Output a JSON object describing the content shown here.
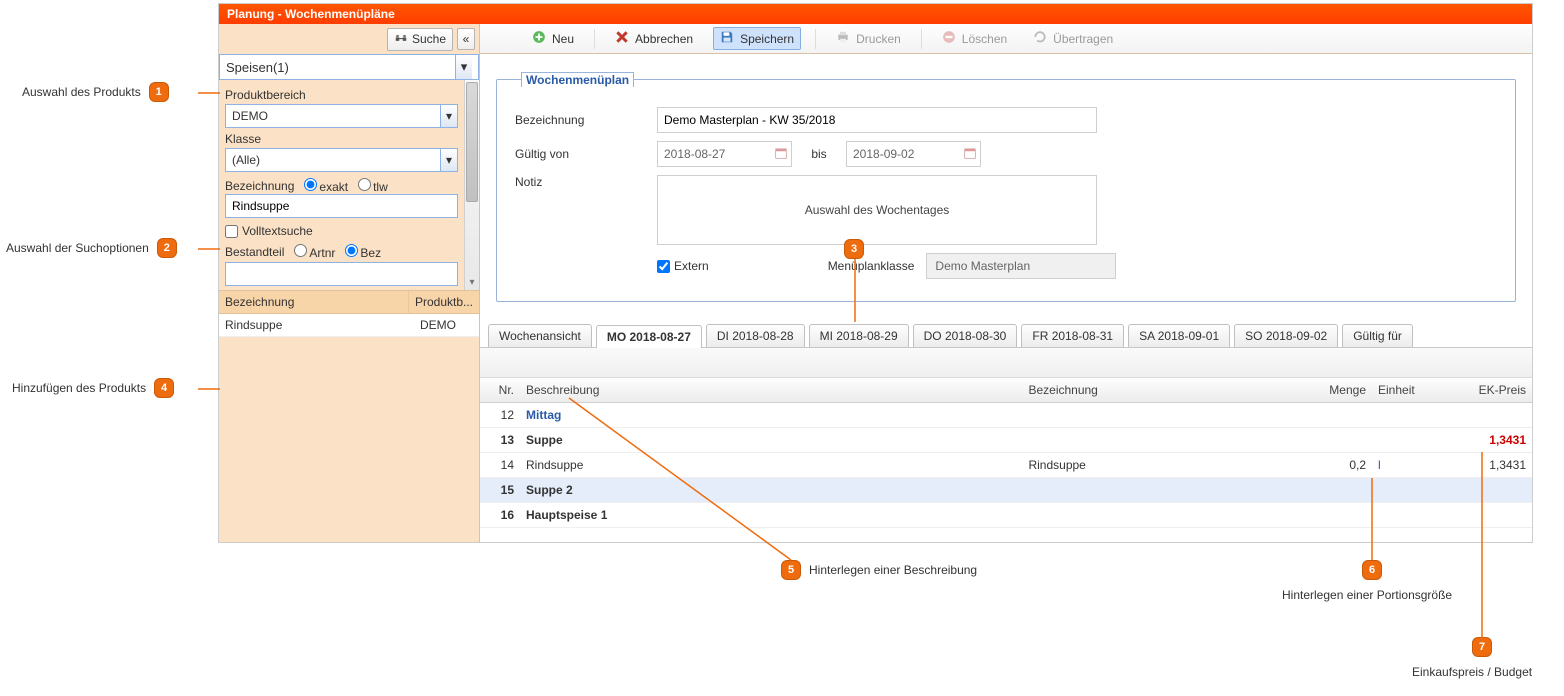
{
  "title": "Planung - Wochenmenüpläne",
  "toolbar": {
    "neu": "Neu",
    "abbrechen": "Abbrechen",
    "speichern": "Speichern",
    "drucken": "Drucken",
    "loeschen": "Löschen",
    "uebertragen": "Übertragen"
  },
  "sidebar": {
    "suche_btn": "Suche",
    "product_select": "Speisen(1)",
    "produktbereich_label": "Produktbereich",
    "produktbereich_value": "DEMO",
    "klasse_label": "Klasse",
    "klasse_value": "(Alle)",
    "bezeichnung_label": "Bezeichnung",
    "exakt": "exakt",
    "tlw": "tlw",
    "bezeichnung_value": "Rindsuppe",
    "volltext": "Volltextsuche",
    "bestandteil_label": "Bestandteil",
    "artnr": "Artnr",
    "bez": "Bez",
    "results_headers": {
      "bezeichnung": "Bezeichnung",
      "produkt": "Produktb..."
    },
    "results": [
      {
        "bezeichnung": "Rindsuppe",
        "produkt": "DEMO"
      }
    ]
  },
  "form": {
    "legend": "Wochenmenüplan",
    "bezeichnung_label": "Bezeichnung",
    "bezeichnung_value": "Demo Masterplan - KW 35/2018",
    "gueltig_von_label": "Gültig von",
    "gueltig_von_value": "2018-08-27",
    "bis_label": "bis",
    "bis_value": "2018-09-02",
    "notiz_label": "Notiz",
    "notiz_placeholder": "Auswahl des Wochentages",
    "extern_label": "Extern",
    "menueplanklasse_label": "Menüplanklasse",
    "menueplanklasse_value": "Demo Masterplan"
  },
  "tabs": {
    "wochenansicht": "Wochenansicht",
    "mo": "MO 2018-08-27",
    "di": "DI 2018-08-28",
    "mi": "MI 2018-08-29",
    "do": "DO 2018-08-30",
    "fr": "FR 2018-08-31",
    "sa": "SA 2018-09-01",
    "so": "SO 2018-09-02",
    "gueltig": "Gültig für"
  },
  "grid": {
    "headers": {
      "nr": "Nr.",
      "besch": "Beschreibung",
      "bez": "Bezeichnung",
      "menge": "Menge",
      "einh": "Einheit",
      "preis": "EK-Preis"
    },
    "rows": [
      {
        "nr": "12",
        "besch": "Mittag",
        "bez": "",
        "menge": "",
        "einh": "",
        "preis": "",
        "style": "blue"
      },
      {
        "nr": "13",
        "besch": "Suppe",
        "bez": "",
        "menge": "",
        "einh": "",
        "preis": "1,3431",
        "style": "bold",
        "preis_red": true
      },
      {
        "nr": "14",
        "besch": "Rindsuppe",
        "bez": "Rindsuppe",
        "menge": "0,2",
        "einh": "l",
        "preis": "1,3431",
        "style": ""
      },
      {
        "nr": "15",
        "besch": "Suppe 2",
        "bez": "",
        "menge": "",
        "einh": "",
        "preis": "",
        "style": "bold selected"
      },
      {
        "nr": "16",
        "besch": "Hauptspeise 1",
        "bez": "",
        "menge": "",
        "einh": "",
        "preis": "",
        "style": "bold"
      }
    ]
  },
  "annotations": {
    "a1": "Auswahl des Produkts",
    "a2": "Auswahl der Suchoptionen",
    "a3_badge_target": "3",
    "a4": "Hinzufügen des Produkts",
    "a5": "Hinterlegen einer Beschreibung",
    "a6": "Hinterlegen einer Portionsgröße",
    "a7": "Einkaufspreis / Budget"
  }
}
